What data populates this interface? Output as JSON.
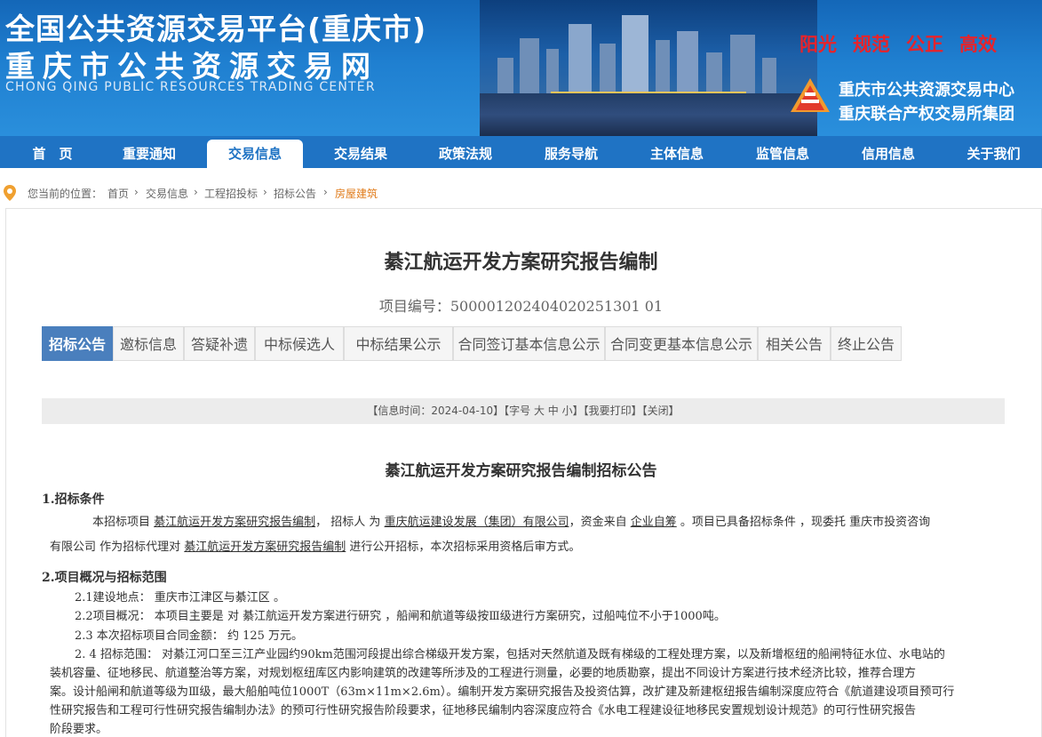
{
  "header": {
    "line1": "全国公共资源交易平台(重庆市)",
    "line2": "重庆市公共资源交易网",
    "line3": "CHONG QING PUBLIC RESOURCES TRADING CENTER",
    "slogans": [
      "阳光",
      "规范",
      "公正",
      "高效"
    ],
    "org1": "重庆市公共资源交易中心",
    "org2": "重庆联合产权交易所集团",
    "colors": {
      "banner": "#1f7fd0",
      "slogan": "#e8232a",
      "nav": "#1f73c4"
    }
  },
  "nav": {
    "items": [
      "首　页",
      "重要通知",
      "交易信息",
      "交易结果",
      "政策法规",
      "服务导航",
      "主体信息",
      "监管信息",
      "信用信息",
      "关于我们"
    ],
    "active": "交易信息"
  },
  "breadcrumb": {
    "label": "您当前的位置：",
    "segments": [
      "首页",
      "交易信息",
      "工程招投标",
      "招标公告",
      "房屋建筑"
    ],
    "separator": "›",
    "icon": "location-pin-icon"
  },
  "page": {
    "title": "綦江航运开发方案研究报告编制",
    "project_no": "项目编号：500001202404020251301 01"
  },
  "tabs": [
    "招标公告",
    "邀标信息",
    "答疑补遗",
    "中标候选人",
    "中标结果公示",
    "合同签订基本信息公示",
    "合同变更基本信息公示",
    "相关公告",
    "终止公告"
  ],
  "infobar": "【信息时间：2024-04-10】【字号 大 中 小】【我要打印】【关闭】",
  "article": {
    "title": "綦江航运开发方案研究报告编制招标公告",
    "h1": "1.招标条件",
    "p1a_1": "本招标项目 ",
    "p1a_2": "綦江航运开发方案研究报告编制",
    "p1a_3": "， 招标人 为 ",
    "p1a_4": "重庆航运建设发展（集团）有限公司",
    "p1a_5": "，资金来自 ",
    "p1a_6": "企业自筹",
    "p1a_7": " 。项目已具备招标条件 ，现委托 重庆市投资咨询",
    "p1b_1": "有限公司 作为招标代理对 ",
    "p1b_2": "綦江航运开发方案研究报告编制",
    "p1b_3": " 进行公开招标，本次招标采用资格后审方式。",
    "h2": "2.项目概况与招标范围",
    "p21": "2.1建设地点： 重庆市江津区与綦江区 。",
    "p22": "2.2项目概况： 本项目主要是 对 綦江航运开发方案进行研究 ，船闸和航道等级按Ⅲ级进行方案研究，过船吨位不小于1000吨。",
    "p23": "2.3 本次招标项目合同金额： 约 125 万元。",
    "p24a": "2. 4 招标范围： 对綦江河口至三江产业园约90km范围河段提出综合梯级开发方案，包括对天然航道及既有梯级的工程处理方案，以及新增枢纽的船闸特征水位、水电站的",
    "p24b": "装机容量、征地移民、航道整治等方案，对规划枢纽库区内影响建筑的改建等所涉及的工程进行测量，必要的地质勘察，提出不同设计方案进行技术经济比较，推荐合理方",
    "p24c": "案。设计船闸和航道等级为Ⅲ级，最大船舶吨位1000T（63m×11m×2.6m）。编制开发方案研究报告及投资估算，改扩建及新建枢纽报告编制深度应符合《航道建设项目预可行",
    "p24d": "性研究报告和工程可行性研究报告编制办法》的预可行性研究报告阶段要求，征地移民编制内容深度应符合《水电工程建设征地移民安置规划设计规范》的可行性研究报告",
    "p24e": "阶段要求。"
  }
}
